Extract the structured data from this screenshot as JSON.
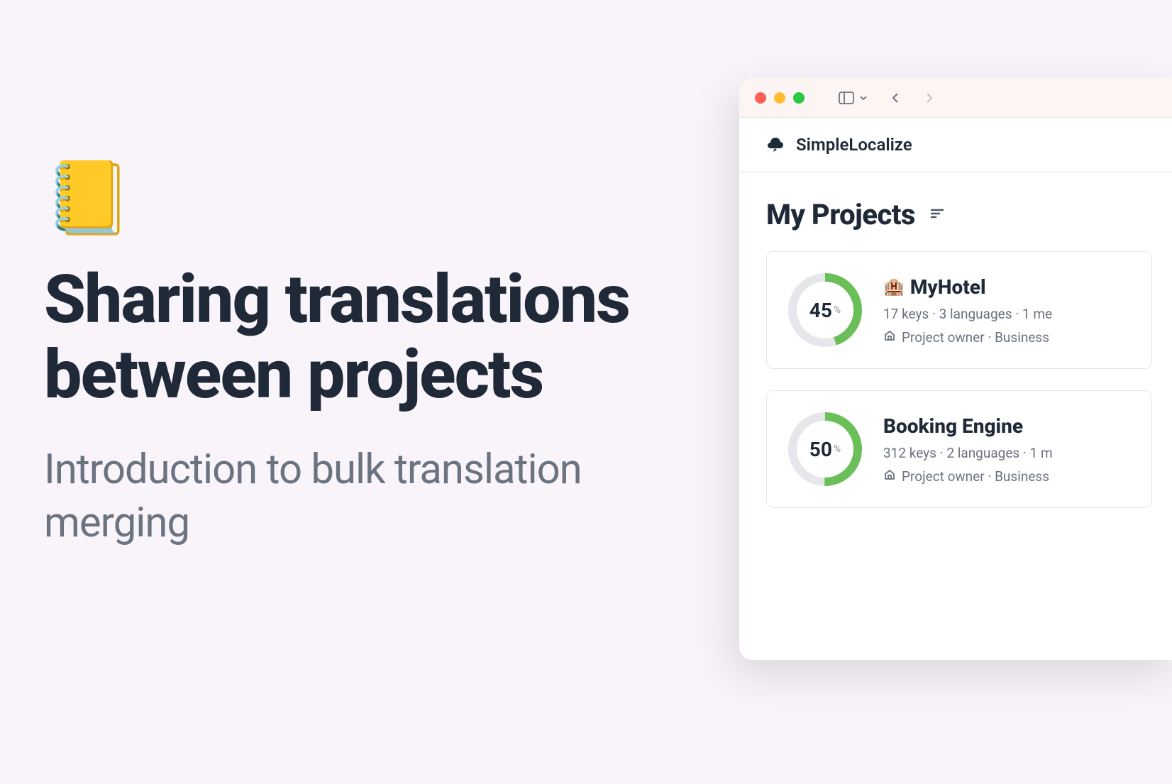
{
  "hero": {
    "icon": "📒",
    "title": "Sharing translations between projects",
    "subtitle": "Introduction to bulk translation merging"
  },
  "browser": {
    "app_name": "SimpleLocalize",
    "section_title": "My Projects"
  },
  "projects": [
    {
      "emoji": "🏨",
      "name": "MyHotel",
      "percent": 45,
      "keys": "17 keys",
      "languages": "3 languages",
      "members": "1 me",
      "role": "Project owner",
      "plan": "Business"
    },
    {
      "emoji": "",
      "name": "Booking Engine",
      "percent": 50,
      "keys": "312 keys",
      "languages": "2 languages",
      "members": "1 m",
      "role": "Project owner",
      "plan": "Business"
    }
  ]
}
